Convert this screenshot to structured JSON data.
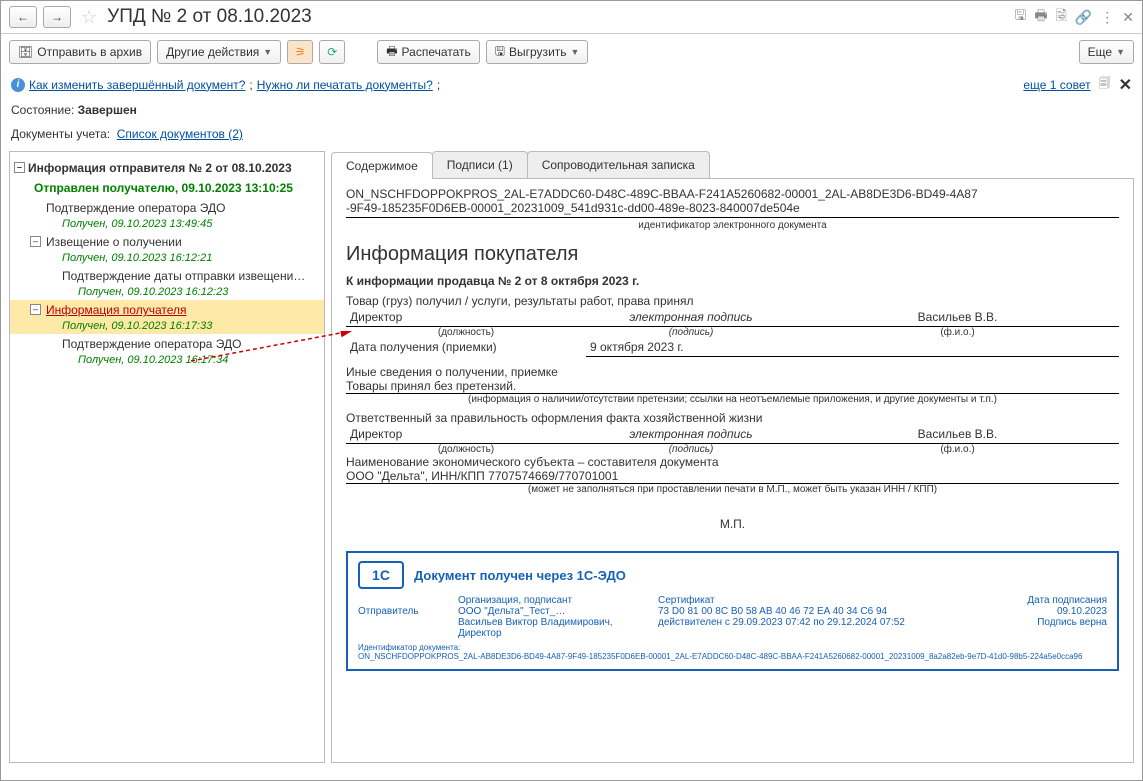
{
  "title": "УПД № 2 от 08.10.2023",
  "toolbar": {
    "archive": "Отправить в архив",
    "other": "Другие действия",
    "print": "Распечатать",
    "export": "Выгрузить",
    "more": "Еще"
  },
  "info": {
    "link1": "Как изменить завершённый документ?",
    "link2": "Нужно ли печатать документы?",
    "more_tips": "еще 1 совет"
  },
  "status": {
    "label": "Состояние:",
    "value": "Завершен"
  },
  "docs": {
    "label": "Документы учета:",
    "link": "Список документов (2)"
  },
  "tree": {
    "root": "Информация отправителя № 2 от 08.10.2023",
    "sent": "Отправлен получателю, 09.10.2023 13:10:25",
    "n1": "Подтверждение оператора ЭДО",
    "n1_stamp": "Получен, 09.10.2023 13:49:45",
    "n2": "Извещение о получении",
    "n2_stamp": "Получен, 09.10.2023 16:12:21",
    "n3": "Подтверждение даты отправки извещени…",
    "n3_stamp": "Получен, 09.10.2023 16:12:23",
    "n4": "Информация получателя",
    "n4_stamp": "Получен, 09.10.2023 16:17:33",
    "n5": "Подтверждение оператора ЭДО",
    "n5_stamp": "Получен, 09.10.2023 16:17:34"
  },
  "tabs": {
    "t1": "Содержимое",
    "t2": "Подписи (1)",
    "t3": "Сопроводительная записка"
  },
  "doc": {
    "id1": "ON_NSCHFDOPPOKPROS_2AL-E7ADDC60-D48C-489C-BBAA-F241A5260682-00001_2AL-AB8DE3D6-BD49-4A87",
    "id2": "-9F49-185235F0D6EB-00001_20231009_541d931c-dd00-489e-8023-840007de504e",
    "id_cap": "идентификатор электронного документа",
    "h1": "Информация покупателя",
    "sub": "К информации продавца № 2 от 8 октября 2023 г.",
    "goods": "Товар (груз) получил / услуги, результаты работ, права принял",
    "role": "Директор",
    "sig": "электронная подпись",
    "fio": "Васильев В.В.",
    "cap_role": "(должность)",
    "cap_sig": "(подпись)",
    "cap_fio": "(ф.и.о.)",
    "date_lbl": "Дата получения (приемки)",
    "date_val": "9 октября 2023 г.",
    "other_lbl": "Иные сведения о получении, приемке",
    "other_val": "Товары принял без претензий.",
    "other_cap": "(информация о наличии/отсутствии претензии; ссылки на неотъемлемые приложения, и другие документы и т.п.)",
    "resp": "Ответственный за правильность оформления факта хозяйственной жизни",
    "org_lbl": "Наименование экономического субъекта – составителя документа",
    "org_val": "ООО \"Дельта\", ИНН/КПП 7707574669/770701001",
    "org_cap": "(может не заполняться при проставлении печати в М.П., может быть указан ИНН / КПП)",
    "mp": "М.П."
  },
  "stamp": {
    "title": "Документ получен через 1С-ЭДО",
    "sender_lbl": "Отправитель",
    "org_hdr": "Организация, подписант",
    "org": "ООО \"Дельта\"_Тест_…",
    "person": "Васильев Виктор Владимирович, Директор",
    "cert_hdr": "Сертификат",
    "cert": "73 D0 81 00 8C B0 58 AB 40 46 72 EA 40 34 C6 94",
    "cert_valid": "действителен с 29.09.2023 07:42 по 29.12.2024 07:52",
    "date_hdr": "Дата подписания",
    "date": "09.10.2023",
    "valid": "Подпись верна",
    "small_lbl": "Идентификатор документа:",
    "small": "ON_NSCHFDOPPOKPROS_2AL-AB8DE3D6-BD49-4A87-9F49-185235F0D6EB-00001_2AL-E7ADDC60-D48C-489C-BBAA-F241A5260682-00001_20231009_8a2a82eb-9e7D-41d0-98b5-224a5e0cca96"
  }
}
